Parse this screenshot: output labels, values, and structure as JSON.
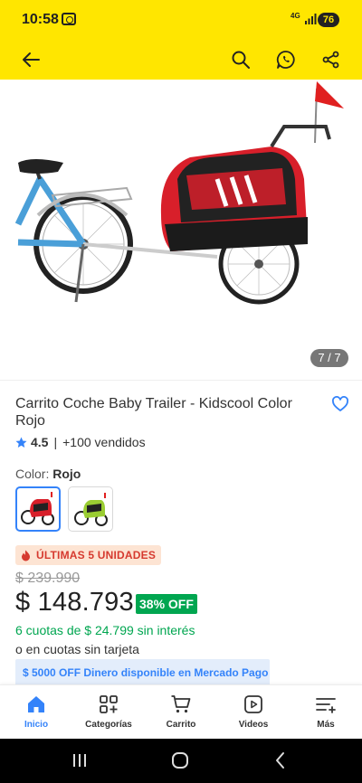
{
  "status": {
    "time": "10:58",
    "network": "4G",
    "battery": "76",
    "icons": [
      "screenshot-icon",
      "signal-icon"
    ]
  },
  "header": {
    "background": "#ffe600",
    "icons": [
      "back-arrow-icon",
      "search-icon",
      "whatsapp-icon",
      "share-icon"
    ]
  },
  "gallery": {
    "counter": "7 / 7"
  },
  "product": {
    "title": "Carrito Coche Baby Trailer - Kidscool Color Rojo",
    "rating": "4.5",
    "rating_separator": "|",
    "sold": "+100 vendidos",
    "color_label": "Color: ",
    "color_value": "Rojo",
    "swatches": [
      {
        "color": "red",
        "selected": true
      },
      {
        "color": "green",
        "selected": false
      }
    ],
    "stock_badge": "ÚLTIMAS 5 UNIDADES",
    "old_price": "$ 239.990",
    "price": "$ 148.793",
    "discount": "38% OFF",
    "installments": "6 cuotas de $ 24.799 sin interés",
    "no_card": "o en cuotas sin tarjeta",
    "promo_banner": "$ 5000 OFF Dinero disponible en Mercado Pago"
  },
  "bottom_nav": [
    {
      "label": "Inicio",
      "icon": "home-icon",
      "active": true
    },
    {
      "label": "Categorías",
      "icon": "categories-icon",
      "active": false
    },
    {
      "label": "Carrito",
      "icon": "cart-icon",
      "active": false
    },
    {
      "label": "Videos",
      "icon": "video-icon",
      "active": false
    },
    {
      "label": "Más",
      "icon": "more-menu-icon",
      "active": false
    }
  ],
  "colors": {
    "accent": "#3483fa",
    "green": "#00a650",
    "stock_red": "#d63a2f"
  }
}
